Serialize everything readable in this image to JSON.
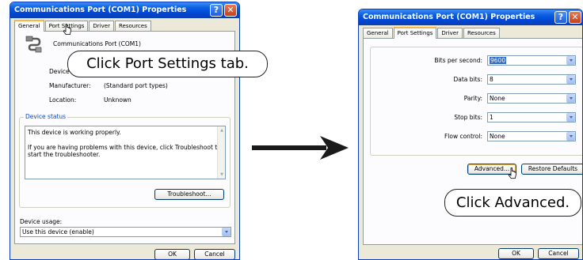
{
  "left_window": {
    "title": "Communications Port (COM1) Properties",
    "help_btn": "?",
    "close_btn": "✕",
    "tabs": [
      "General",
      "Port Settings",
      "Driver",
      "Resources"
    ],
    "device_name": "Communications Port (COM1)",
    "device_type_label": "Device type:",
    "manufacturer_label": "Manufacturer:",
    "manufacturer_value": "(Standard port types)",
    "location_label": "Location:",
    "location_value": "Unknown",
    "device_status_title": "Device status",
    "status_line1": "This device is working properly.",
    "status_line2": "If you are having problems with this device, click Troubleshoot to",
    "status_line3": "start the troubleshooter.",
    "troubleshoot_btn": "Troubleshoot...",
    "device_usage_label": "Device usage:",
    "device_usage_value": "Use this device (enable)",
    "ok_btn": "OK",
    "cancel_btn": "Cancel"
  },
  "right_window": {
    "title": "Communications Port (COM1) Properties",
    "help_btn": "?",
    "close_btn": "✕",
    "tabs": [
      "General",
      "Port Settings",
      "Driver",
      "Resources"
    ],
    "fields": [
      {
        "label": "Bits per second:",
        "value": "9600"
      },
      {
        "label": "Data bits:",
        "value": "8"
      },
      {
        "label": "Parity:",
        "value": "None"
      },
      {
        "label": "Stop bits:",
        "value": "1"
      },
      {
        "label": "Flow control:",
        "value": "None"
      }
    ],
    "advanced_btn": "Advanced...",
    "restore_btn": "Restore Defaults",
    "ok_btn": "OK",
    "cancel_btn": "Cancel"
  },
  "callouts": {
    "step1": "Click Port Settings tab.",
    "step2": "Click Advanced."
  },
  "icons": {
    "left_device": "serial-port-icon",
    "arrow": "right-arrow-icon",
    "cursor": "pointer-cursor-icon"
  },
  "colors": {
    "titlebar": "#0046d5",
    "active_tab_accent": "#f7b64a",
    "selection": "#316ac5"
  }
}
